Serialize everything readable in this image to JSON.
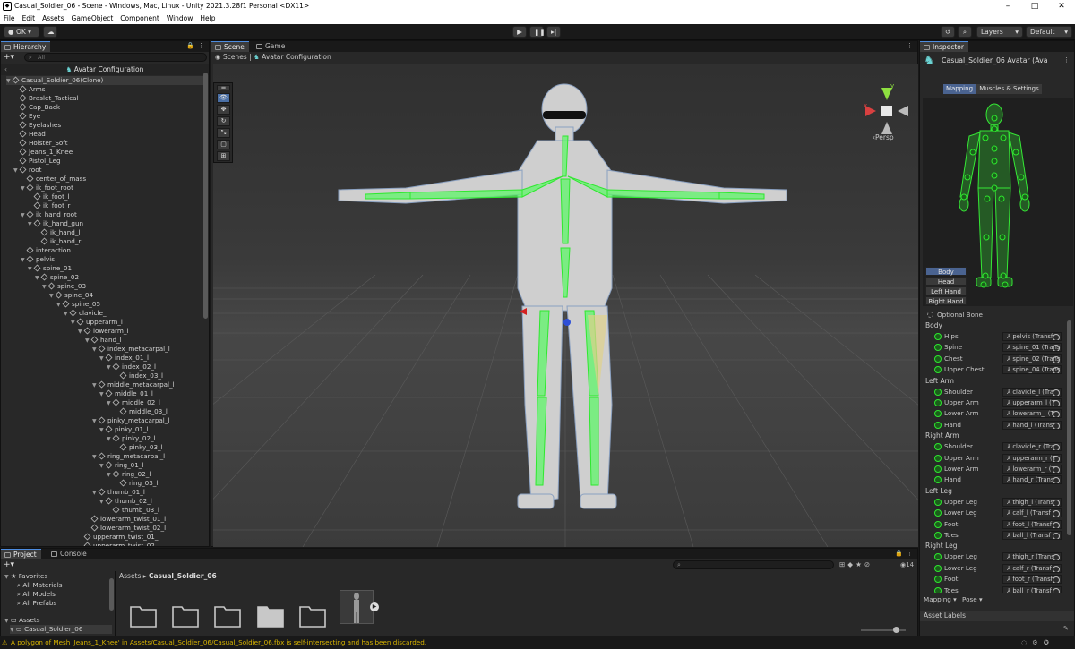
{
  "window": {
    "title": "Casual_Soldier_06 - Scene - Windows, Mac, Linux - Unity 2021.3.28f1 Personal <DX11>",
    "controls": [
      "–",
      "□",
      "✕"
    ]
  },
  "menu": [
    "File",
    "Edit",
    "Assets",
    "GameObject",
    "Component",
    "Window",
    "Help"
  ],
  "toolbar": {
    "account_label": "OK",
    "layers_label": "Layers",
    "layout_label": "Default"
  },
  "hierarchy": {
    "tab": "Hierarchy",
    "search_placeholder": "All",
    "header": "Avatar Configuration",
    "rows": [
      {
        "label": "Casual_Soldier_06(Clone)",
        "depth": 0,
        "arrow": true
      },
      {
        "label": "Arms",
        "depth": 1
      },
      {
        "label": "Braslet_Tactical",
        "depth": 1
      },
      {
        "label": "Cap_Back",
        "depth": 1
      },
      {
        "label": "Eye",
        "depth": 1
      },
      {
        "label": "Eyelashes",
        "depth": 1
      },
      {
        "label": "Head",
        "depth": 1
      },
      {
        "label": "Holster_Soft",
        "depth": 1
      },
      {
        "label": "Jeans_1_Knee",
        "depth": 1
      },
      {
        "label": "Pistol_Leg",
        "depth": 1
      },
      {
        "label": "root",
        "depth": 1,
        "arrow": true
      },
      {
        "label": "center_of_mass",
        "depth": 2
      },
      {
        "label": "ik_foot_root",
        "depth": 2,
        "arrow": true
      },
      {
        "label": "ik_foot_l",
        "depth": 3
      },
      {
        "label": "ik_foot_r",
        "depth": 3
      },
      {
        "label": "ik_hand_root",
        "depth": 2,
        "arrow": true
      },
      {
        "label": "ik_hand_gun",
        "depth": 3,
        "arrow": true
      },
      {
        "label": "ik_hand_l",
        "depth": 4
      },
      {
        "label": "ik_hand_r",
        "depth": 4
      },
      {
        "label": "interaction",
        "depth": 2
      },
      {
        "label": "pelvis",
        "depth": 2,
        "arrow": true
      },
      {
        "label": "spine_01",
        "depth": 3,
        "arrow": true
      },
      {
        "label": "spine_02",
        "depth": 4,
        "arrow": true
      },
      {
        "label": "spine_03",
        "depth": 5,
        "arrow": true
      },
      {
        "label": "spine_04",
        "depth": 6,
        "arrow": true
      },
      {
        "label": "spine_05",
        "depth": 7,
        "arrow": true
      },
      {
        "label": "clavicle_l",
        "depth": 8,
        "arrow": true
      },
      {
        "label": "upperarm_l",
        "depth": 9,
        "arrow": true
      },
      {
        "label": "lowerarm_l",
        "depth": 10,
        "arrow": true
      },
      {
        "label": "hand_l",
        "depth": 11,
        "arrow": true
      },
      {
        "label": "index_metacarpal_l",
        "depth": 12,
        "arrow": true
      },
      {
        "label": "index_01_l",
        "depth": 13,
        "arrow": true
      },
      {
        "label": "index_02_l",
        "depth": 14,
        "arrow": true
      },
      {
        "label": "index_03_l",
        "depth": 15
      },
      {
        "label": "middle_metacarpal_l",
        "depth": 12,
        "arrow": true
      },
      {
        "label": "middle_01_l",
        "depth": 13,
        "arrow": true
      },
      {
        "label": "middle_02_l",
        "depth": 14,
        "arrow": true
      },
      {
        "label": "middle_03_l",
        "depth": 15
      },
      {
        "label": "pinky_metacarpal_l",
        "depth": 12,
        "arrow": true
      },
      {
        "label": "pinky_01_l",
        "depth": 13,
        "arrow": true
      },
      {
        "label": "pinky_02_l",
        "depth": 14,
        "arrow": true
      },
      {
        "label": "pinky_03_l",
        "depth": 15
      },
      {
        "label": "ring_metacarpal_l",
        "depth": 12,
        "arrow": true
      },
      {
        "label": "ring_01_l",
        "depth": 13,
        "arrow": true
      },
      {
        "label": "ring_02_l",
        "depth": 14,
        "arrow": true
      },
      {
        "label": "ring_03_l",
        "depth": 15
      },
      {
        "label": "thumb_01_l",
        "depth": 12,
        "arrow": true
      },
      {
        "label": "thumb_02_l",
        "depth": 13,
        "arrow": true
      },
      {
        "label": "thumb_03_l",
        "depth": 14
      },
      {
        "label": "lowerarm_twist_01_l",
        "depth": 11
      },
      {
        "label": "lowerarm_twist_02_l",
        "depth": 11
      },
      {
        "label": "upperarm_twist_01_l",
        "depth": 10
      },
      {
        "label": "upperarm_twist_02_l",
        "depth": 10
      }
    ]
  },
  "scene": {
    "tabs": [
      "Scene",
      "Game"
    ],
    "breadcrumb_root": "Scenes",
    "breadcrumb_current": "Avatar Configuration",
    "view_2d": "2D",
    "persp_label": "‹Persp",
    "gizmo_axes": [
      "y",
      "x"
    ]
  },
  "inspector": {
    "tab": "Inspector",
    "title": "Casual_Soldier_06 Avatar (Ava",
    "tabs": [
      "Mapping",
      "Muscles & Settings"
    ],
    "body_parts": [
      "Body",
      "Head",
      "Left Hand",
      "Right Hand"
    ],
    "optional_bone": "Optional Bone",
    "groups": [
      {
        "name": "Body",
        "bones": [
          [
            "Hips",
            "pelvis (Transf"
          ],
          [
            "Spine",
            "spine_01 (Trans"
          ],
          [
            "Chest",
            "spine_02 (Trans"
          ],
          [
            "Upper Chest",
            "spine_04 (Trans"
          ]
        ]
      },
      {
        "name": "Left Arm",
        "bones": [
          [
            "Shoulder",
            "clavicle_l (Tra"
          ],
          [
            "Upper Arm",
            "upperarm_l (T"
          ],
          [
            "Lower Arm",
            "lowerarm_l (T"
          ],
          [
            "Hand",
            "hand_l (Trans"
          ]
        ]
      },
      {
        "name": "Right Arm",
        "bones": [
          [
            "Shoulder",
            "clavicle_r (Tra"
          ],
          [
            "Upper Arm",
            "upperarm_r (T"
          ],
          [
            "Lower Arm",
            "lowerarm_r (T"
          ],
          [
            "Hand",
            "hand_r (Trans"
          ]
        ]
      },
      {
        "name": "Left Leg",
        "bones": [
          [
            "Upper Leg",
            "thigh_l (Trans"
          ],
          [
            "Lower Leg",
            "calf_l (Transf"
          ],
          [
            "Foot",
            "foot_l (Transf"
          ],
          [
            "Toes",
            "ball_l (Transf"
          ]
        ]
      },
      {
        "name": "Right Leg",
        "bones": [
          [
            "Upper Leg",
            "thigh_r (Trans"
          ],
          [
            "Lower Leg",
            "calf_r (Transf"
          ],
          [
            "Foot",
            "foot_r (Transf"
          ],
          [
            "Toes",
            "ball_r (Transf"
          ]
        ]
      }
    ],
    "footer_mapping": "Mapping ▾",
    "footer_pose": "Pose ▾",
    "asset_labels": "Asset Labels"
  },
  "project": {
    "tabs": [
      "Project",
      "Console"
    ],
    "favorites_label": "Favorites",
    "favorites": [
      "All Materials",
      "All Models",
      "All Prefabs"
    ],
    "assets_label": "Assets",
    "assets_child": "Casual_Soldier_06",
    "breadcrumb_root": "Assets",
    "breadcrumb_current": "Casual_Soldier_06",
    "layer_count": "14"
  },
  "status": {
    "message": "A polygon of Mesh 'Jeans_1_Knee' in Assets/Casual_Soldier_06/Casual_Soldier_06.fbx is self-intersecting and has been discarded."
  },
  "colors": {
    "accent": "#4d8ce0",
    "bone_green": "#2ee82e",
    "warning": "#d8b400"
  }
}
